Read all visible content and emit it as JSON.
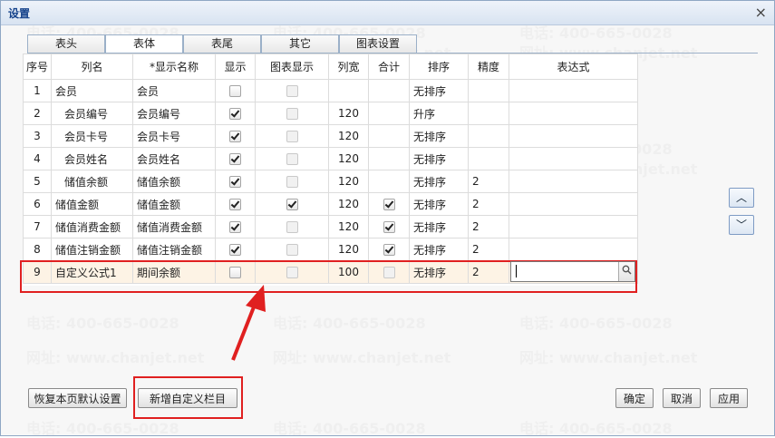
{
  "dialog": {
    "title": "设置",
    "close_glyph": "×"
  },
  "tabs": [
    "表头",
    "表体",
    "表尾",
    "其它",
    "图表设置"
  ],
  "active_tab": "表体",
  "columns": [
    "序号",
    "列名",
    "*显示名称",
    "显示",
    "图表显示",
    "列宽",
    "合计",
    "排序",
    "精度",
    "表达式"
  ],
  "rows": [
    {
      "no": "1",
      "name": "会员",
      "display": "会员",
      "show": false,
      "chart": false,
      "width": "",
      "sum": null,
      "sort": "无排序",
      "precision": "",
      "expr": ""
    },
    {
      "no": "2",
      "name": "会员编号",
      "display": "会员编号",
      "show": true,
      "chart": false,
      "width": "120",
      "sum": null,
      "sort": "升序",
      "precision": "",
      "expr": ""
    },
    {
      "no": "3",
      "name": "会员卡号",
      "display": "会员卡号",
      "show": true,
      "chart": false,
      "width": "120",
      "sum": null,
      "sort": "无排序",
      "precision": "",
      "expr": ""
    },
    {
      "no": "4",
      "name": "会员姓名",
      "display": "会员姓名",
      "show": true,
      "chart": false,
      "width": "120",
      "sum": null,
      "sort": "无排序",
      "precision": "",
      "expr": ""
    },
    {
      "no": "5",
      "name": "储值余额",
      "display": "储值余额",
      "show": true,
      "chart": false,
      "width": "120",
      "sum": null,
      "sort": "无排序",
      "precision": "2",
      "expr": ""
    },
    {
      "no": "6",
      "name": "储值金额",
      "display": "储值金额",
      "show": true,
      "chart": true,
      "width": "120",
      "sum": true,
      "sort": "无排序",
      "precision": "2",
      "expr": ""
    },
    {
      "no": "7",
      "name": "储值消费金额",
      "display": "储值消费金额",
      "show": true,
      "chart": false,
      "width": "120",
      "sum": true,
      "sort": "无排序",
      "precision": "2",
      "expr": ""
    },
    {
      "no": "8",
      "name": "储值注销金额",
      "display": "储值注销金额",
      "show": true,
      "chart": false,
      "width": "120",
      "sum": true,
      "sort": "无排序",
      "precision": "2",
      "expr": ""
    },
    {
      "no": "9",
      "name": "自定义公式1",
      "display": "期间余额",
      "show": false,
      "chart": false,
      "width": "100",
      "sum": false,
      "sort": "无排序",
      "precision": "2",
      "expr": ""
    }
  ],
  "selected_row": "9",
  "expr_button_icon": "magnifier-icon",
  "side_buttons": {
    "up": "︿",
    "down": "﹀"
  },
  "buttons": {
    "restore": "恢复本页默认设置",
    "add_custom": "新增自定义栏目",
    "ok": "确定",
    "cancel": "取消",
    "apply": "应用"
  },
  "watermark": {
    "phone": "电话: 400-665-0028",
    "site": "网址: www.chanjet.net"
  },
  "colors": {
    "highlight_red": "#e02020",
    "selected_row_bg": "#fdf3e5",
    "title_blue": "#15428b"
  }
}
